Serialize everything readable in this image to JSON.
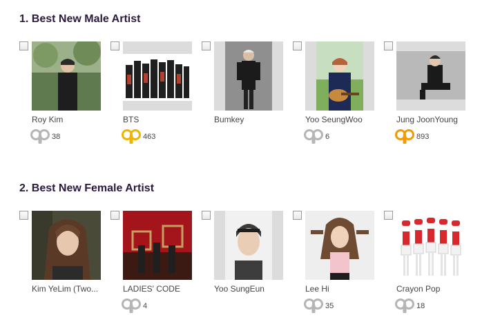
{
  "sections": [
    {
      "title": "1. Best New Male Artist",
      "artists": [
        {
          "name": "Roy Kim",
          "votes": "38",
          "vote_icon": "gray-vote-icon",
          "highlighted": false
        },
        {
          "name": "BTS",
          "votes": "463",
          "vote_icon": "gold-vote-icon",
          "highlighted": true
        },
        {
          "name": "Bumkey",
          "votes": "",
          "vote_icon": "",
          "highlighted": false
        },
        {
          "name": "Yoo SeungWoo",
          "votes": "6",
          "vote_icon": "gray-vote-icon",
          "highlighted": false
        },
        {
          "name": "Jung JoonYoung",
          "votes": "893",
          "vote_icon": "orange-vote-icon",
          "highlighted": true
        }
      ]
    },
    {
      "title": "2. Best New Female Artist",
      "artists": [
        {
          "name": "Kim YeLim (Two...",
          "votes": "",
          "vote_icon": "",
          "highlighted": false
        },
        {
          "name": "LADIES' CODE",
          "votes": "4",
          "vote_icon": "gray-vote-icon",
          "highlighted": false
        },
        {
          "name": "Yoo SungEun",
          "votes": "",
          "vote_icon": "",
          "highlighted": false
        },
        {
          "name": "Lee Hi",
          "votes": "35",
          "vote_icon": "gray-vote-icon",
          "highlighted": false
        },
        {
          "name": "Crayon Pop",
          "votes": "18",
          "vote_icon": "gray-vote-icon",
          "highlighted": false
        }
      ]
    }
  ],
  "colors": {
    "title": "#2b1a3d",
    "vote_gray": "#b5b5b5",
    "vote_gold": "#f0b400",
    "vote_orange": "#f29a00",
    "photo_bg": "#dcdcdc"
  }
}
